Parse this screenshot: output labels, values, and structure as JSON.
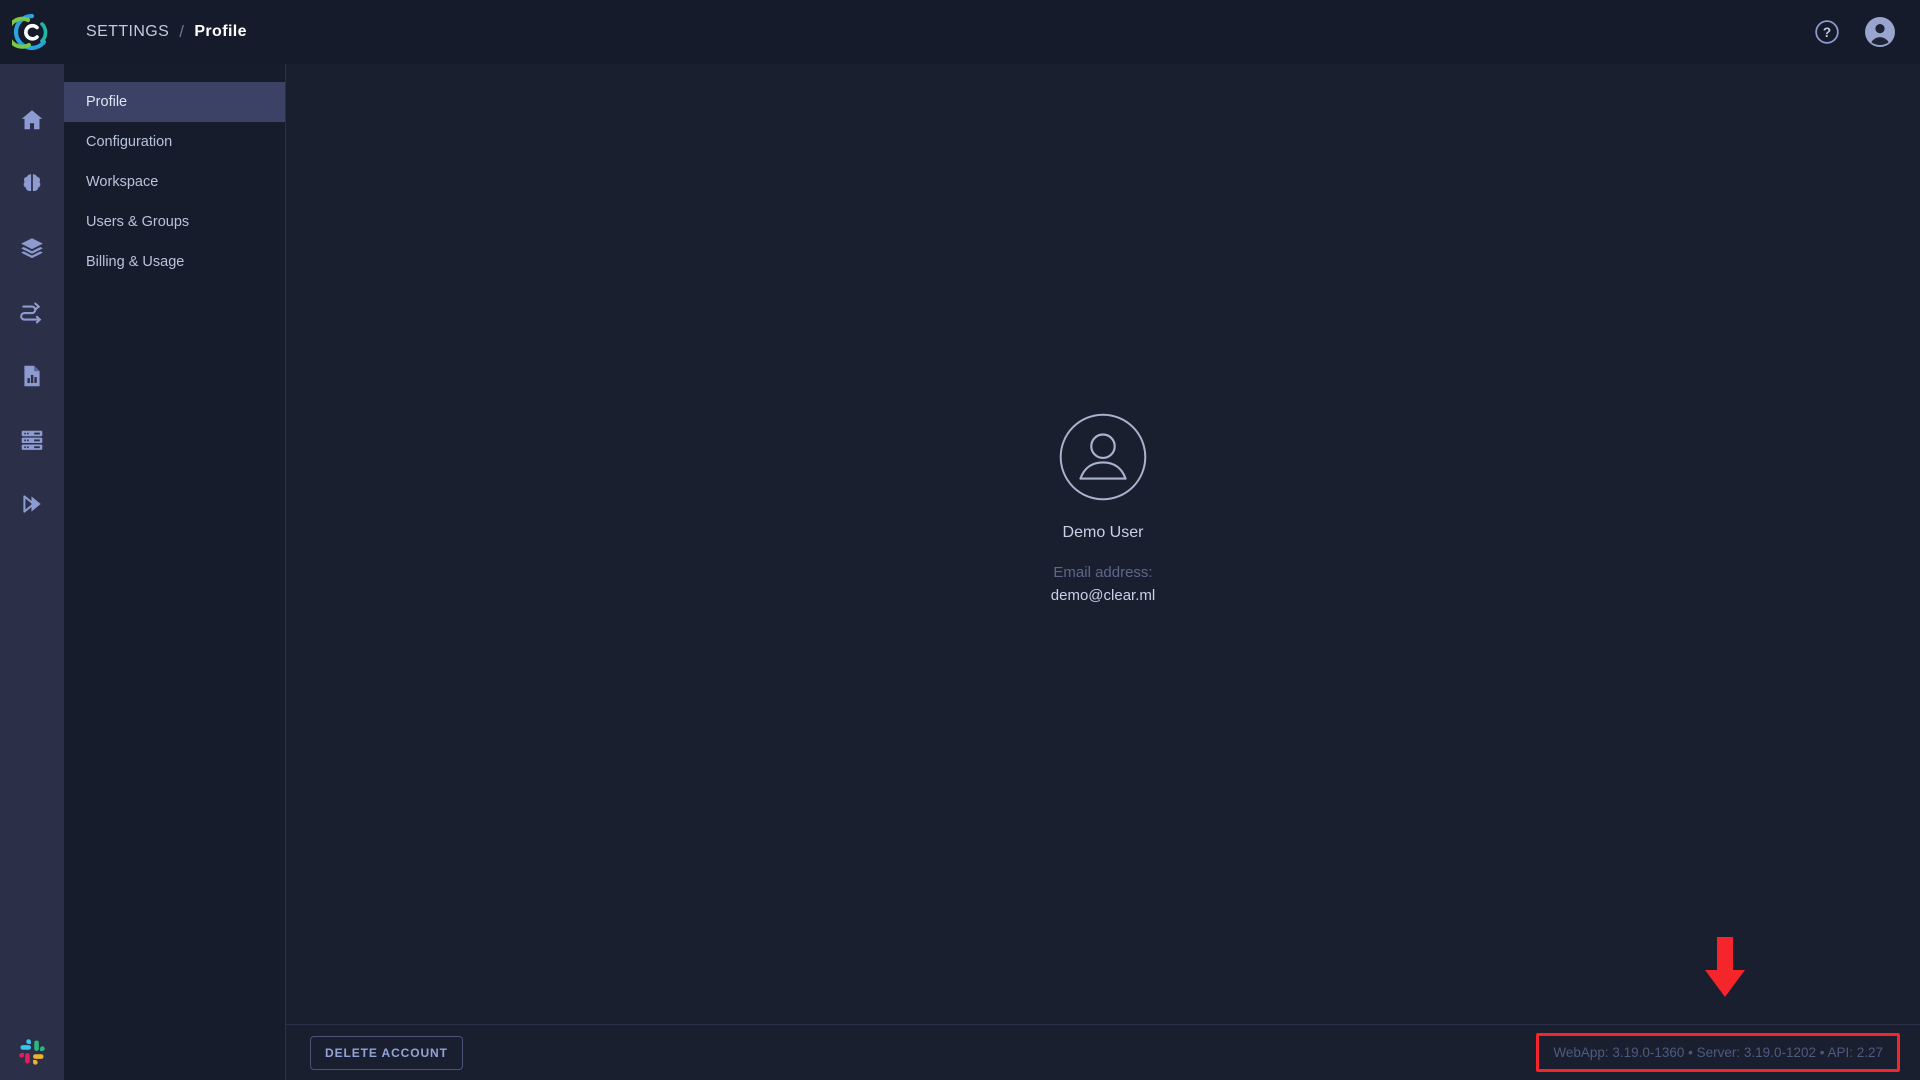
{
  "app": {
    "logo_icon": "clearml-logo",
    "brand_colors": {
      "blue": "#2aa3e0",
      "green": "#7ac943",
      "teal": "#1fb8a6"
    }
  },
  "rail": {
    "items": [
      {
        "icon": "home-icon",
        "name": "home"
      },
      {
        "icon": "brain-icon",
        "name": "experiments"
      },
      {
        "icon": "layers-icon",
        "name": "datasets"
      },
      {
        "icon": "pipeline-icon",
        "name": "pipelines"
      },
      {
        "icon": "report-icon",
        "name": "reports"
      },
      {
        "icon": "server-icon",
        "name": "resources"
      },
      {
        "icon": "double-chevron-icon",
        "name": "applications"
      }
    ],
    "bottom_icon": "slack-icon"
  },
  "header": {
    "breadcrumb_root": "SETTINGS",
    "breadcrumb_separator": "/",
    "breadcrumb_current": "Profile",
    "help_icon": "question-circle-icon",
    "account_icon": "user-avatar-icon"
  },
  "sidebar": {
    "items": [
      {
        "label": "Profile",
        "active": true
      },
      {
        "label": "Configuration",
        "active": false
      },
      {
        "label": "Workspace",
        "active": false
      },
      {
        "label": "Users & Groups",
        "active": false
      },
      {
        "label": "Billing & Usage",
        "active": false
      }
    ]
  },
  "profile": {
    "avatar_icon": "user-avatar-outline-icon",
    "user_name": "Demo User",
    "email_label": "Email address:",
    "email_value": "demo@clear.ml"
  },
  "footer": {
    "delete_button": "DELETE ACCOUNT",
    "version_text": "WebApp: 3.19.0-1360 • Server: 3.19.0-1202 • API: 2.27"
  },
  "annotation": {
    "arrow_icon": "down-arrow-annotation",
    "highlight_color": "#f4252b"
  }
}
